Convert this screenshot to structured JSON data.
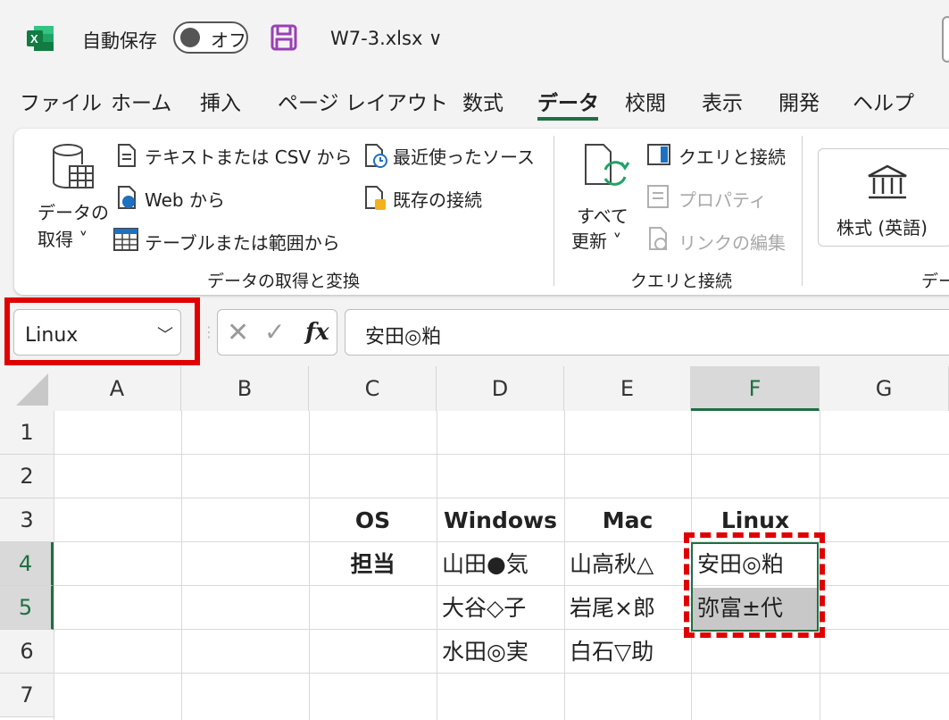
{
  "titlebar": {
    "autosave_label": "自動保存",
    "autosave_state": "オフ",
    "filename": "W7-3.xlsx ∨"
  },
  "menu": {
    "tabs": [
      "ファイル",
      "ホーム",
      "挿入",
      "ページ レイアウト",
      "数式",
      "データ",
      "校閲",
      "表示",
      "開発",
      "ヘルプ"
    ],
    "active": "データ"
  },
  "ribbon": {
    "get_data": {
      "line1": "データの",
      "line2": "取得 ˅"
    },
    "from_text_csv": "テキストまたは CSV から",
    "from_web": "Web から",
    "from_table": "テーブルまたは範囲から",
    "recent_sources": "最近使ったソース",
    "existing_connections": "既存の接続",
    "group1_label": "データの取得と変換",
    "refresh_all": {
      "line1": "すべて",
      "line2": "更新 ˅"
    },
    "queries_connections": "クエリと接続",
    "properties": "プロパティ",
    "edit_links": "リンクの編集",
    "group2_label": "クエリと接続",
    "stocks": "株式 (英語)",
    "group3_label": "デー"
  },
  "formula_bar": {
    "name_box": "Linux",
    "formula": "安田◎粕"
  },
  "sheet": {
    "columns": [
      "A",
      "B",
      "C",
      "D",
      "E",
      "F",
      "G"
    ],
    "selected_column": "F",
    "rows": [
      "1",
      "2",
      "3",
      "4",
      "5",
      "6",
      "7"
    ],
    "selected_rows": [
      "4",
      "5"
    ],
    "header_row": {
      "C": "OS",
      "D": "Windows",
      "E": "Mac",
      "F": "Linux"
    },
    "row4": {
      "C": "担当",
      "D": "山田●気",
      "E": "山高秋△",
      "F": "安田◎粕"
    },
    "row5": {
      "D": "大谷◇子",
      "E": "岩尾×郎",
      "F": "弥富±代"
    },
    "row6": {
      "D": "水田◎実",
      "E": "白石▽助"
    }
  },
  "colors": {
    "excel_green": "#1f6f43",
    "highlight_red": "#e00000",
    "selected_cell_gray": "#c8c8c8"
  }
}
